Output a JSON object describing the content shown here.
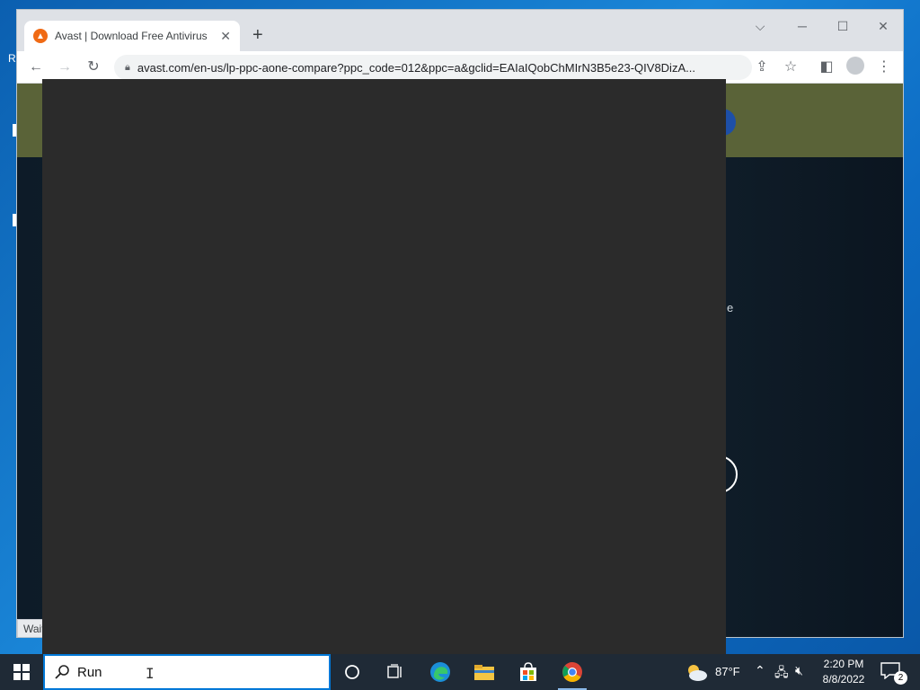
{
  "browser": {
    "tab_title": "Avast | Download Free Antivirus",
    "tab_favicon": "avast-logo-icon",
    "url": "avast.com/en-us/lp-ppc-aone-compare?ppc_code=012&ppc=a&gclid=EAIaIQobChMIrN3B5e23-QIV8DizA...",
    "status_text": "Wait",
    "page_side_text": "e"
  },
  "taskbar": {
    "search_value": "Run",
    "weather_temp": "87°F",
    "clock_time": "2:20 PM",
    "clock_date": "8/8/2022",
    "notification_count": "2"
  },
  "colors": {
    "overlay": "#2b2b2b",
    "taskbar": "#1f2a36",
    "search_focus": "#0078d7",
    "avast_orange": "#f06a14"
  }
}
